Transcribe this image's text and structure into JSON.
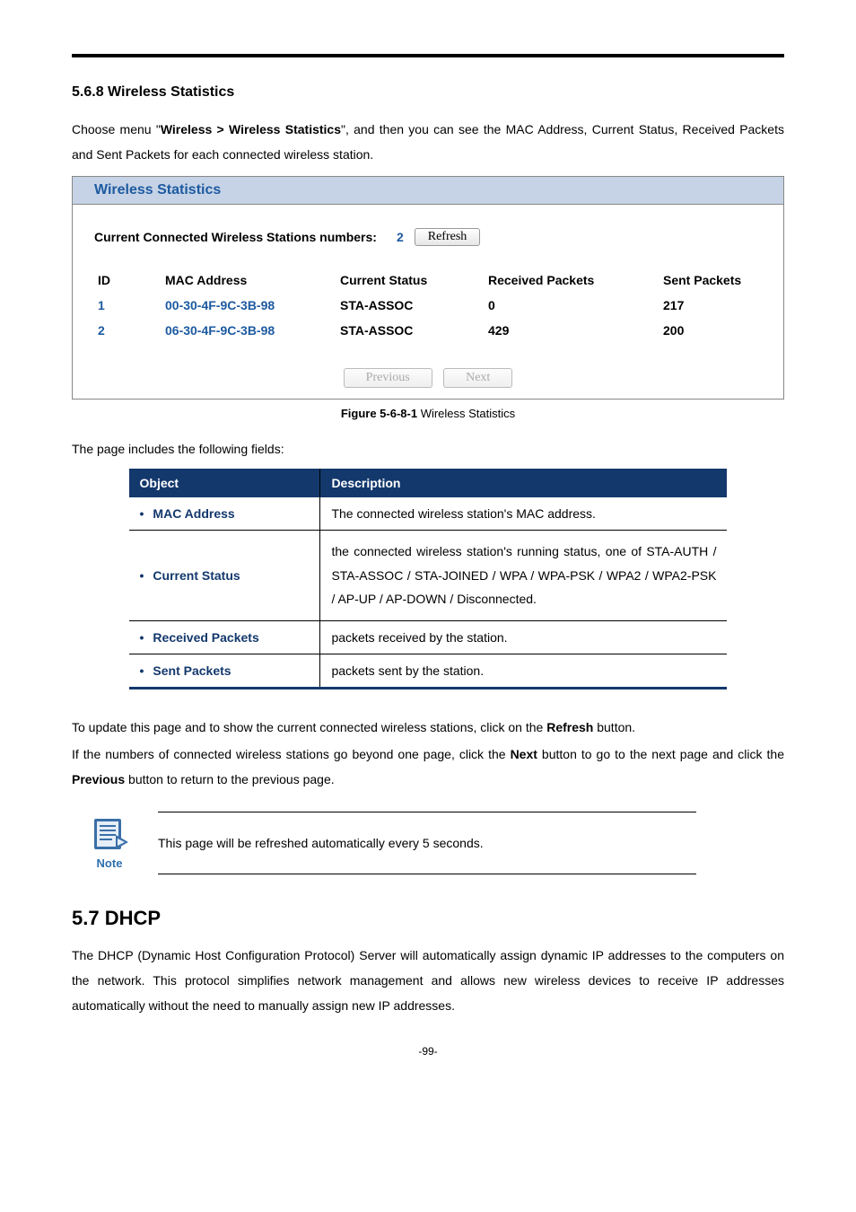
{
  "section_heading": "5.6.8  Wireless Statistics",
  "intro_pre": "Choose menu \"",
  "intro_bold": "Wireless > Wireless Statistics",
  "intro_post": "\", and then you can see the MAC Address, Current Status, Received Packets and Sent Packets for each connected wireless station.",
  "panel": {
    "title": "Wireless Statistics",
    "conn_label": "Current Connected Wireless Stations numbers:",
    "conn_num": "2",
    "refresh": "Refresh",
    "headers": {
      "id": "ID",
      "mac": "MAC Address",
      "status": "Current Status",
      "recv": "Received Packets",
      "sent": "Sent Packets"
    },
    "rows": [
      {
        "id": "1",
        "mac": "00-30-4F-9C-3B-98",
        "status": "STA-ASSOC",
        "recv": "0",
        "sent": "217"
      },
      {
        "id": "2",
        "mac": "06-30-4F-9C-3B-98",
        "status": "STA-ASSOC",
        "recv": "429",
        "sent": "200"
      }
    ],
    "prev": "Previous",
    "next": "Next"
  },
  "figure_caption_bold": "Figure 5-6-8-1",
  "figure_caption_rest": " Wireless Statistics",
  "fields_intro": "The page includes the following fields:",
  "desc_headers": {
    "obj": "Object",
    "desc": "Description"
  },
  "desc_rows": [
    {
      "obj": "MAC Address",
      "desc": "The connected wireless station's MAC address."
    },
    {
      "obj": "Current Status",
      "desc": "the connected wireless station's running status, one of STA-AUTH / STA-ASSOC / STA-JOINED / WPA / WPA-PSK / WPA2 / WPA2-PSK / AP-UP / AP-DOWN / Disconnected."
    },
    {
      "obj": "Received Packets",
      "desc": "packets received by the station."
    },
    {
      "obj": "Sent Packets",
      "desc": "packets sent by the station."
    }
  ],
  "update_p1_pre": "To update this page and to show the current connected wireless stations, click on the ",
  "update_p1_b": "Refresh",
  "update_p1_post": " button.",
  "update_p2_pre": "If the numbers of connected wireless stations go beyond one page, click the ",
  "update_p2_b1": "Next",
  "update_p2_mid": " button to go to the next page and click the ",
  "update_p2_b2": "Previous",
  "update_p2_post": " button to return to the previous page.",
  "note_label": "Note",
  "note_text": "This page will be refreshed automatically every 5 seconds.",
  "dhcp_heading": "5.7  DHCP",
  "dhcp_para": "The DHCP (Dynamic Host Configuration Protocol) Server will automatically assign dynamic IP addresses to the computers on the network. This protocol simplifies network management and allows new wireless devices to receive IP addresses automatically without the need to manually assign new IP addresses.",
  "page_number": "-99-"
}
